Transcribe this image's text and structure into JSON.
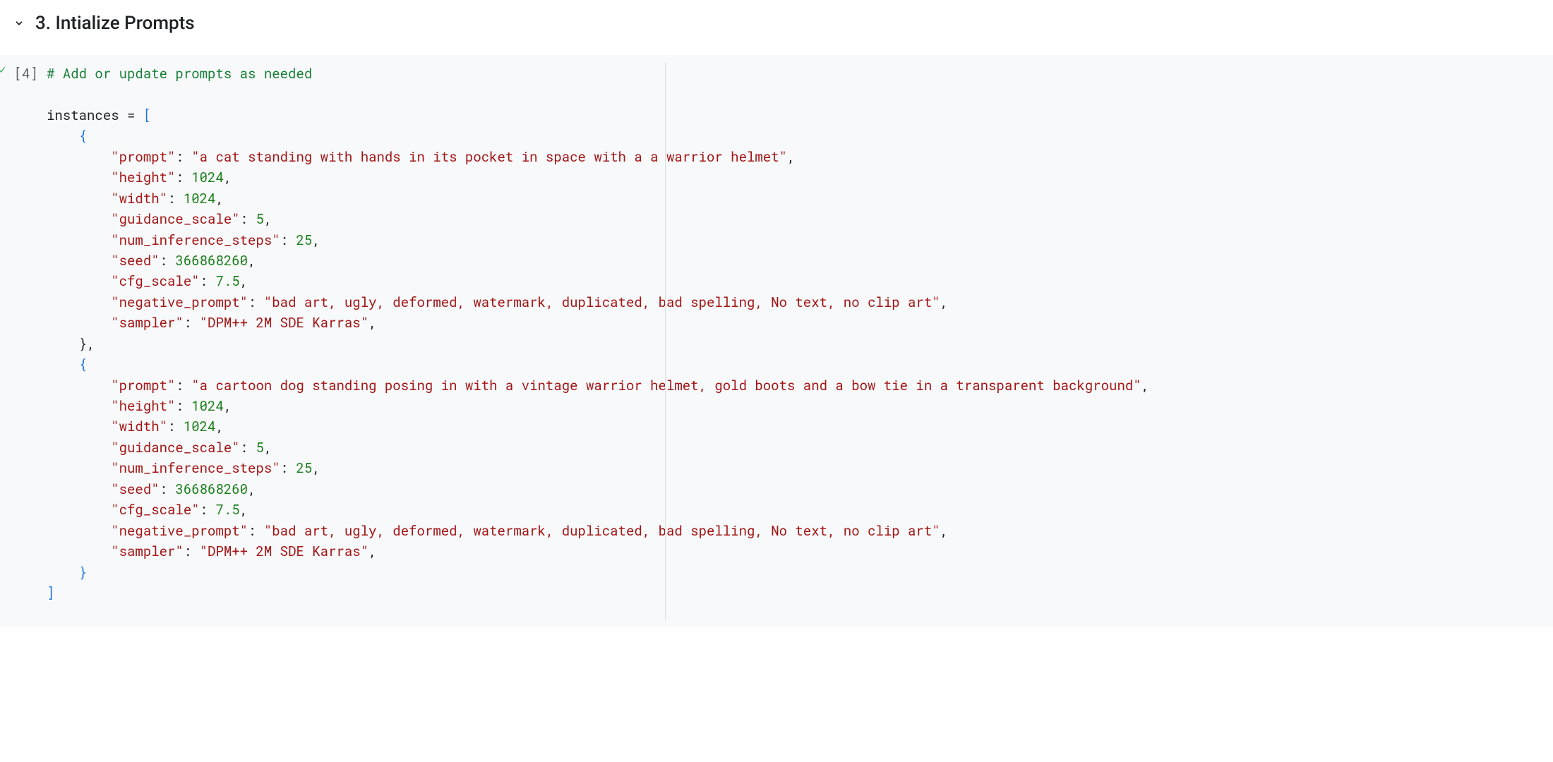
{
  "section": {
    "title": "3. Intialize Prompts"
  },
  "cell": {
    "exec_label": "[4]",
    "exec_check": "✓",
    "code": {
      "comment": "# Add or update prompts as needed",
      "assign_lhs": "instances",
      "assign_eq": " = ",
      "open_bracket": "[",
      "instances": [
        {
          "open": "{",
          "fields": [
            {
              "key": "\"prompt\"",
              "sep": ": ",
              "val": "\"a cat standing with hands in its pocket in space with a a warrior helmet\"",
              "type": "str",
              "comma": ","
            },
            {
              "key": "\"height\"",
              "sep": ": ",
              "val": "1024",
              "type": "num",
              "comma": ","
            },
            {
              "key": "\"width\"",
              "sep": ": ",
              "val": "1024",
              "type": "num",
              "comma": ","
            },
            {
              "key": "\"guidance_scale\"",
              "sep": ": ",
              "val": "5",
              "type": "num",
              "comma": ","
            },
            {
              "key": "\"num_inference_steps\"",
              "sep": ": ",
              "val": "25",
              "type": "num",
              "comma": ","
            },
            {
              "key": "\"seed\"",
              "sep": ": ",
              "val": "366868260",
              "type": "num",
              "comma": ","
            },
            {
              "key": "\"cfg_scale\"",
              "sep": ": ",
              "val": "7.5",
              "type": "num",
              "comma": ","
            },
            {
              "key": "\"negative_prompt\"",
              "sep": ": ",
              "val": "\"bad art, ugly, deformed, watermark, duplicated, bad spelling, No text, no clip art\"",
              "type": "str",
              "comma": ","
            },
            {
              "key": "\"sampler\"",
              "sep": ": ",
              "val": "\"DPM++ 2M SDE Karras\"",
              "type": "str",
              "comma": ","
            }
          ],
          "close": "},",
          "close_cls": "pun"
        },
        {
          "open": "{",
          "fields": [
            {
              "key": "\"prompt\"",
              "sep": ": ",
              "val": "\"a cartoon dog standing posing in with a vintage warrior helmet, gold boots and a bow tie in a transparent background\"",
              "type": "str",
              "comma": ","
            },
            {
              "key": "\"height\"",
              "sep": ": ",
              "val": "1024",
              "type": "num",
              "comma": ","
            },
            {
              "key": "\"width\"",
              "sep": ": ",
              "val": "1024",
              "type": "num",
              "comma": ","
            },
            {
              "key": "\"guidance_scale\"",
              "sep": ": ",
              "val": "5",
              "type": "num",
              "comma": ","
            },
            {
              "key": "\"num_inference_steps\"",
              "sep": ": ",
              "val": "25",
              "type": "num",
              "comma": ","
            },
            {
              "key": "\"seed\"",
              "sep": ": ",
              "val": "366868260",
              "type": "num",
              "comma": ","
            },
            {
              "key": "\"cfg_scale\"",
              "sep": ": ",
              "val": "7.5",
              "type": "num",
              "comma": ","
            },
            {
              "key": "\"negative_prompt\"",
              "sep": ": ",
              "val": "\"bad art, ugly, deformed, watermark, duplicated, bad spelling, No text, no clip art\"",
              "type": "str",
              "comma": ","
            },
            {
              "key": "\"sampler\"",
              "sep": ": ",
              "val": "\"DPM++ 2M SDE Karras\"",
              "type": "str",
              "comma": ","
            }
          ],
          "close": "}",
          "close_cls": "brc"
        }
      ],
      "close_bracket": "]"
    }
  }
}
